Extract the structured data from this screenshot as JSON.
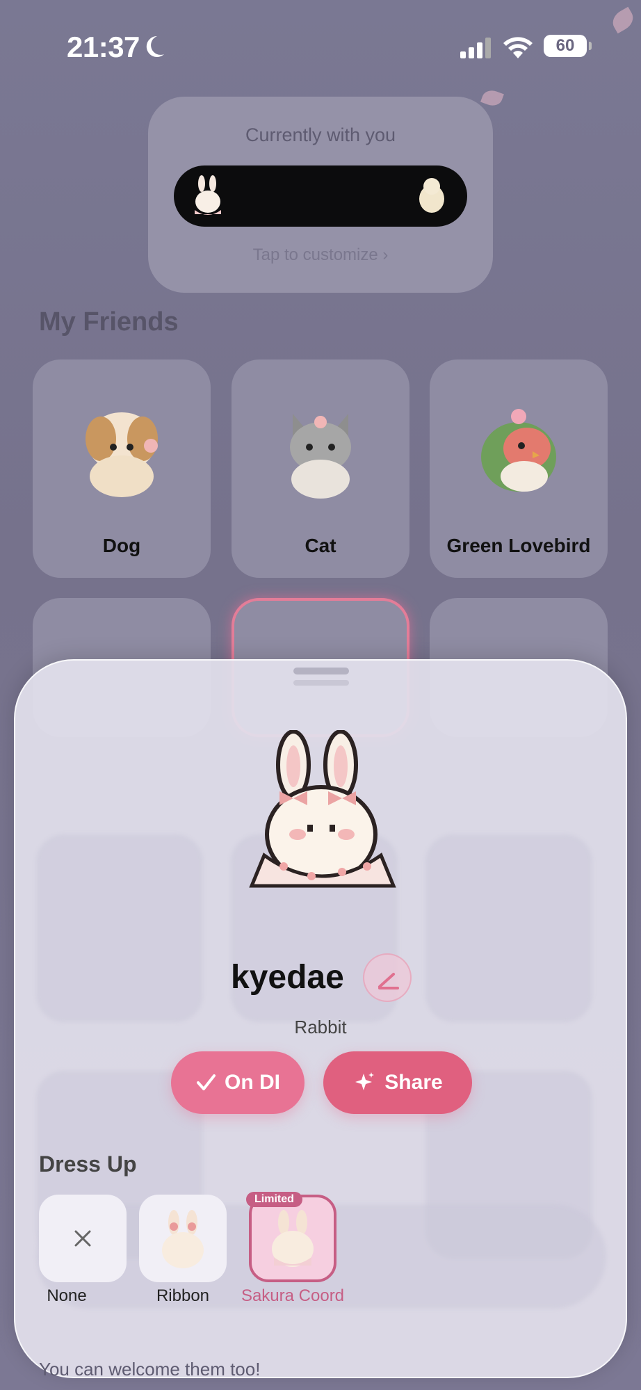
{
  "status_bar": {
    "time": "21:37",
    "battery": "60"
  },
  "widget": {
    "title": "Currently with you",
    "cta": "Tap to customize ›"
  },
  "friends": {
    "title": "My Friends",
    "cards": [
      {
        "label": "Dog",
        "color": "#d9b38c"
      },
      {
        "label": "Cat",
        "color": "#9a9a9a"
      },
      {
        "label": "Green Lovebird",
        "color": "#7aa36a"
      }
    ]
  },
  "sheet": {
    "pet_name": "kyedae",
    "species": "Rabbit",
    "on_di_label": "On DI",
    "share_label": "Share",
    "dress_up_title": "Dress Up",
    "dress_options": [
      {
        "label": "None",
        "selected": false
      },
      {
        "label": "Ribbon",
        "selected": false
      },
      {
        "label": "Sakura Coord",
        "selected": true,
        "badge": "Limited"
      }
    ]
  },
  "footer_text": "You can welcome them too!",
  "colors": {
    "accent": "#e87394",
    "sheet_bg": "#e2e0ec",
    "selected": "#c65e84"
  }
}
